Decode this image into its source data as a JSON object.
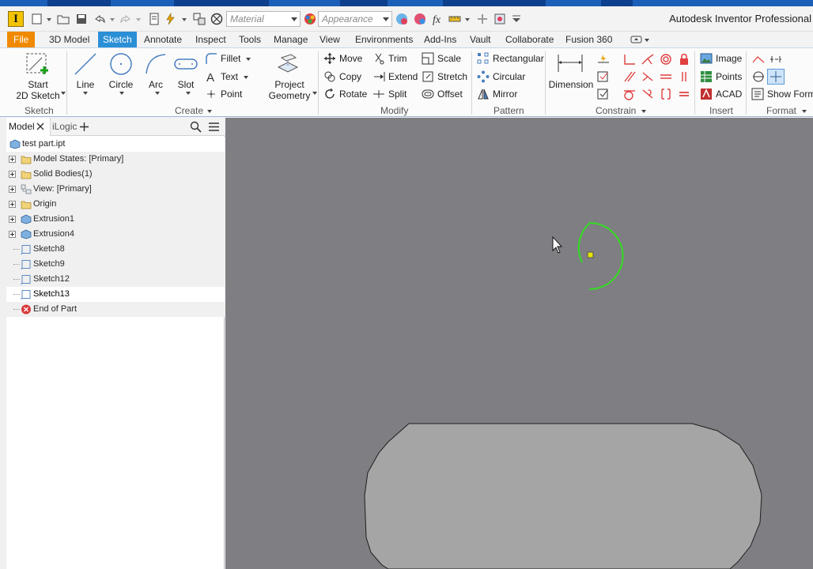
{
  "window": {
    "title": "Autodesk Inventor Professional"
  },
  "qat": {
    "material_value": "Material",
    "appearance_value": "Appearance"
  },
  "tabs": [
    "File",
    "3D Model",
    "Sketch",
    "Annotate",
    "Inspect",
    "Tools",
    "Manage",
    "View",
    "Environments",
    "Add-Ins",
    "Vault",
    "Collaborate",
    "Fusion 360"
  ],
  "active_tab": "Sketch",
  "ribbon": {
    "sketch_panel": {
      "title": "Sketch",
      "start_sketch_line1": "Start",
      "start_sketch_line2": "2D Sketch"
    },
    "create_panel": {
      "title": "Create",
      "line": "Line",
      "circle": "Circle",
      "arc": "Arc",
      "slot": "Slot",
      "fillet": "Fillet",
      "text": "Text",
      "point": "Point",
      "project_geometry_line1": "Project",
      "project_geometry_line2": "Geometry"
    },
    "modify_panel": {
      "title": "Modify",
      "move": "Move",
      "copy": "Copy",
      "rotate": "Rotate",
      "trim": "Trim",
      "extend": "Extend",
      "split": "Split",
      "scale": "Scale",
      "stretch": "Stretch",
      "offset": "Offset"
    },
    "pattern_panel": {
      "title": "Pattern",
      "rectangular": "Rectangular",
      "circular": "Circular",
      "mirror": "Mirror"
    },
    "constrain_panel": {
      "title": "Constrain",
      "dimension": "Dimension"
    },
    "insert_panel": {
      "title": "Insert",
      "image": "Image",
      "points": "Points",
      "acad": "ACAD"
    },
    "format_panel": {
      "title": "Format",
      "show_format": "Show Form"
    }
  },
  "browser": {
    "tab_model": "Model",
    "tab_ilogic": "iLogic",
    "root": "test part.ipt",
    "nodes": [
      {
        "label": "Model States: [Primary]",
        "expandable": true,
        "icon": "folder"
      },
      {
        "label": "Solid Bodies(1)",
        "expandable": true,
        "icon": "folder"
      },
      {
        "label": "View: [Primary]",
        "expandable": true,
        "icon": "view"
      },
      {
        "label": "Origin",
        "expandable": true,
        "icon": "folder"
      },
      {
        "label": "Extrusion1",
        "expandable": true,
        "icon": "extrusion"
      },
      {
        "label": "Extrusion4",
        "expandable": true,
        "icon": "extrusion"
      },
      {
        "label": "Sketch8",
        "expandable": false,
        "icon": "sketch"
      },
      {
        "label": "Sketch9",
        "expandable": false,
        "icon": "sketch"
      },
      {
        "label": "Sketch12",
        "expandable": false,
        "icon": "sketch"
      },
      {
        "label": "Sketch13",
        "expandable": false,
        "icon": "sketch",
        "selected": true
      },
      {
        "label": "End of Part",
        "expandable": false,
        "icon": "end"
      }
    ]
  },
  "colors": {
    "canvas": "#7e7e83",
    "part_face": "#a5a5a5",
    "sketch_arc": "#33dd22",
    "center_point": "#e4e400",
    "active_tab": "#2b8fd6",
    "file_tab": "#f08a00"
  }
}
